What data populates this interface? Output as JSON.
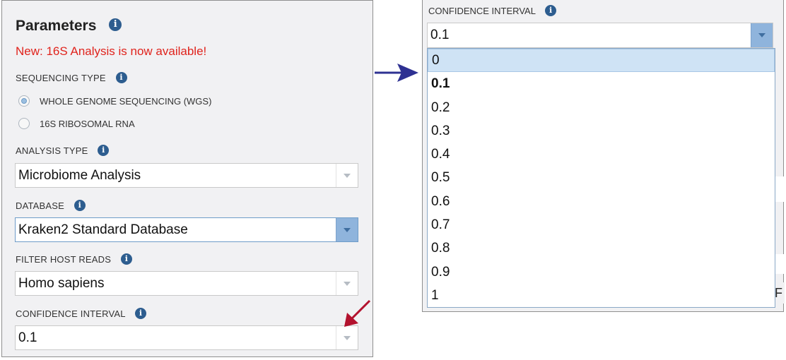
{
  "left_panel": {
    "title": "Parameters",
    "notice": "New: 16S Analysis is now available!",
    "info_glyph": "i",
    "sequencing_type": {
      "label": "SEQUENCING TYPE",
      "options": [
        "WHOLE GENOME SEQUENCING (WGS)",
        "16S RIBOSOMAL RNA"
      ],
      "selected": "WHOLE GENOME SEQUENCING (WGS)"
    },
    "analysis_type": {
      "label": "ANALYSIS TYPE",
      "value": "Microbiome Analysis"
    },
    "database": {
      "label": "DATABASE",
      "value": "Kraken2 Standard Database"
    },
    "filter_host_reads": {
      "label": "FILTER HOST READS",
      "value": "Homo sapiens"
    },
    "confidence_interval": {
      "label": "CONFIDENCE INTERVAL",
      "value": "0.1"
    }
  },
  "right_panel": {
    "label": "CONFIDENCE INTERVAL",
    "value": "0.1",
    "options": [
      "0",
      "0.1",
      "0.2",
      "0.3",
      "0.4",
      "0.5",
      "0.6",
      "0.7",
      "0.8",
      "0.9",
      "1"
    ],
    "highlighted": "0",
    "selected": "0.1",
    "edge_letter": "F"
  },
  "colors": {
    "info_icon": "#2d5d8f",
    "notice": "#e0231c",
    "active_dropdown_button": "#8fb4dc",
    "arrow_right": "#2e3192",
    "arrow_red": "#b3122e"
  },
  "icons": [
    "info-icon",
    "chevron-down-icon",
    "right-arrow-icon",
    "red-pointer-arrow-icon"
  ]
}
